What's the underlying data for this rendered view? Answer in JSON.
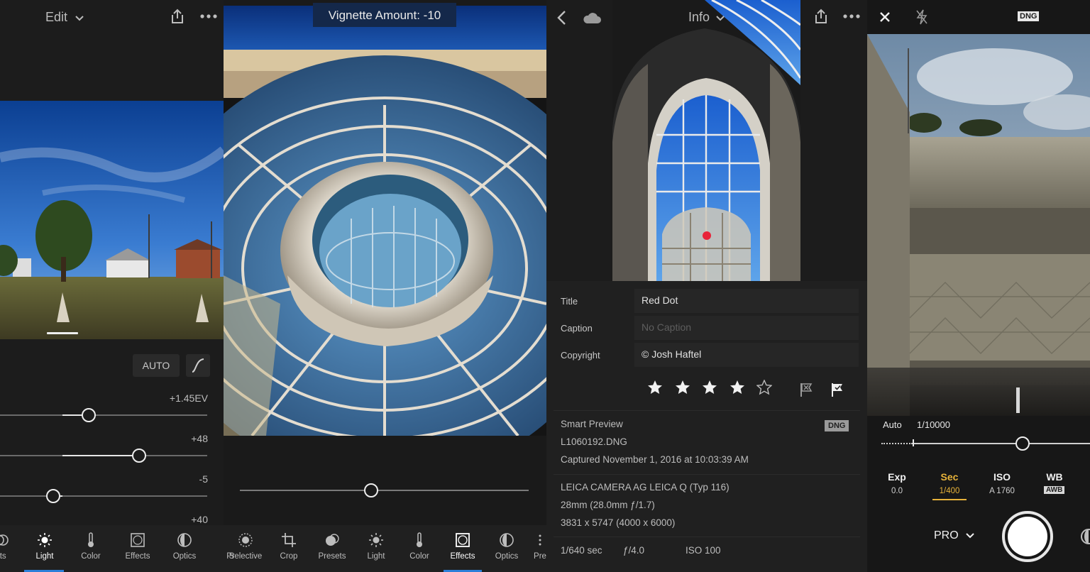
{
  "panel1": {
    "title": "Edit",
    "auto_label": "AUTO",
    "sliders": [
      {
        "value_text": "+1.45EV",
        "fill": 0.4
      },
      {
        "value_text": "+48",
        "fill": 0.65
      },
      {
        "value_text": "-5",
        "fill": 0.24
      },
      {
        "value_text": "+40"
      }
    ],
    "tools": [
      {
        "label": "ets",
        "icon": "presets-icon"
      },
      {
        "label": "Light",
        "icon": "sun-icon",
        "active": true
      },
      {
        "label": "Color",
        "icon": "thermometer-icon"
      },
      {
        "label": "Effects",
        "icon": "vignette-icon"
      },
      {
        "label": "Optics",
        "icon": "lens-icon"
      }
    ]
  },
  "panel2": {
    "banner": "Vignette Amount: -10",
    "slider_fill": 0.45,
    "tools": [
      {
        "label": "Pr",
        "icon": "presets-icon"
      },
      {
        "label": "Selective",
        "icon": "selective-icon"
      },
      {
        "label": "Crop",
        "icon": "crop-icon"
      },
      {
        "label": "Presets",
        "icon": "presets-icon"
      },
      {
        "label": "Light",
        "icon": "sun-icon"
      },
      {
        "label": "Color",
        "icon": "thermometer-icon"
      },
      {
        "label": "Effects",
        "icon": "vignette-icon",
        "active": true
      },
      {
        "label": "Optics",
        "icon": "lens-icon"
      },
      {
        "label": "Pre",
        "icon": "more-vertical-icon"
      }
    ]
  },
  "panel3": {
    "title": "Info",
    "fields": [
      {
        "label": "Title",
        "value": "Red Dot",
        "placeholder": false
      },
      {
        "label": "Caption",
        "value": "No Caption",
        "placeholder": true
      },
      {
        "label": "Copyright",
        "value": "© Josh Haftel",
        "placeholder": false
      }
    ],
    "rating": 4,
    "rating_max": 5,
    "smart_preview": "Smart Preview",
    "dng_badge": "DNG",
    "filename": "L1060192.DNG",
    "captured": "Captured November 1, 2016 at 10:03:39 AM",
    "camera": "LEICA CAMERA AG LEICA Q (Typ 116)",
    "focal": "28mm (28.0mm ƒ/1.7)",
    "dimensions": "3831 x 5747 (4000 x 6000)",
    "shutter": "1/640 sec",
    "aperture": "ƒ/4.0",
    "iso": "ISO 100"
  },
  "panel4": {
    "format_badge": "DNG",
    "auto_label": "Auto",
    "speed_readout": "1/10000",
    "slider_fill": 0.7,
    "params": [
      {
        "label": "Exp",
        "value": "0.0",
        "active": false
      },
      {
        "label": "Sec",
        "value": "1/400",
        "active": true
      },
      {
        "label": "ISO",
        "value": "A 1760",
        "active": false
      },
      {
        "label": "WB",
        "value": "AWB",
        "active": false
      }
    ],
    "mode": "PRO",
    "accent": "#e8b33a"
  },
  "colors": {
    "active_indicator": "#2b7fd9",
    "red_dot": "#e8243a"
  }
}
